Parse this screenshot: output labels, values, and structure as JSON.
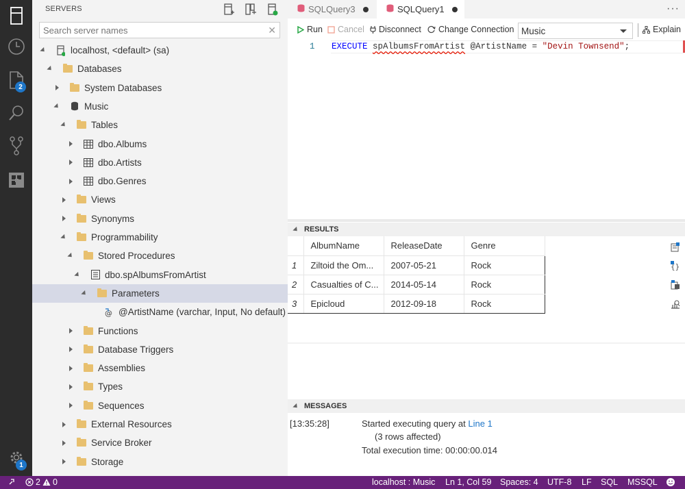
{
  "activity_bar": {
    "explorer_badge": "2",
    "settings_badge": "1"
  },
  "sidebar": {
    "title": "SERVERS",
    "search_placeholder": "Search server names",
    "tree": [
      {
        "label": "localhost, <default> (sa)",
        "depth": 0,
        "state": "expanded",
        "icon": "server-icon"
      },
      {
        "label": "Databases",
        "depth": 1,
        "state": "expanded",
        "icon": "folder-icon"
      },
      {
        "label": "System Databases",
        "depth": 2,
        "state": "collapsed",
        "icon": "folder-icon"
      },
      {
        "label": "Music",
        "depth": 2,
        "state": "expanded",
        "icon": "database-icon"
      },
      {
        "label": "Tables",
        "depth": 3,
        "state": "expanded",
        "icon": "folder-icon"
      },
      {
        "label": "dbo.Albums",
        "depth": 4,
        "state": "collapsed",
        "icon": "table-icon"
      },
      {
        "label": "dbo.Artists",
        "depth": 4,
        "state": "collapsed",
        "icon": "table-icon"
      },
      {
        "label": "dbo.Genres",
        "depth": 4,
        "state": "collapsed",
        "icon": "table-icon"
      },
      {
        "label": "Views",
        "depth": 3,
        "state": "collapsed",
        "icon": "folder-icon"
      },
      {
        "label": "Synonyms",
        "depth": 3,
        "state": "collapsed",
        "icon": "folder-icon"
      },
      {
        "label": "Programmability",
        "depth": 3,
        "state": "expanded",
        "icon": "folder-icon"
      },
      {
        "label": "Stored Procedures",
        "depth": 4,
        "state": "expanded",
        "icon": "folder-icon"
      },
      {
        "label": "dbo.spAlbumsFromArtist",
        "depth": 5,
        "state": "expanded",
        "icon": "stored-procedure-icon"
      },
      {
        "label": "Parameters",
        "depth": 6,
        "state": "expanded",
        "icon": "folder-icon",
        "selected": true
      },
      {
        "label": "@ArtistName (varchar, Input, No default)",
        "depth": 7,
        "state": "leaf",
        "icon": "parameter-icon"
      },
      {
        "label": "Functions",
        "depth": 4,
        "state": "collapsed",
        "icon": "folder-icon"
      },
      {
        "label": "Database Triggers",
        "depth": 4,
        "state": "collapsed",
        "icon": "folder-icon"
      },
      {
        "label": "Assemblies",
        "depth": 4,
        "state": "collapsed",
        "icon": "folder-icon"
      },
      {
        "label": "Types",
        "depth": 4,
        "state": "collapsed",
        "icon": "folder-icon"
      },
      {
        "label": "Sequences",
        "depth": 4,
        "state": "collapsed",
        "icon": "folder-icon"
      },
      {
        "label": "External Resources",
        "depth": 3,
        "state": "collapsed",
        "icon": "folder-icon"
      },
      {
        "label": "Service Broker",
        "depth": 3,
        "state": "collapsed",
        "icon": "folder-icon"
      },
      {
        "label": "Storage",
        "depth": 3,
        "state": "collapsed",
        "icon": "folder-icon"
      }
    ]
  },
  "tabs": [
    {
      "label": "SQLQuery3",
      "active": false
    },
    {
      "label": "SQLQuery1",
      "active": true
    }
  ],
  "more_actions": "···",
  "toolbar": {
    "run": "Run",
    "cancel": "Cancel",
    "disconnect": "Disconnect",
    "change_connection": "Change Connection",
    "database": "Music",
    "explain": "Explain"
  },
  "editor": {
    "line_number": "1",
    "keyword": "EXECUTE",
    "procedure": "spAlbumsFromArtist",
    "middle": " @ArtistName = ",
    "string": "\"Devin Townsend\"",
    "end": ";"
  },
  "results": {
    "header": "RESULTS",
    "columns": [
      "AlbumName",
      "ReleaseDate",
      "Genre"
    ],
    "rows": [
      {
        "n": "1",
        "cells": [
          "Ziltoid the Om...",
          "2007-05-21",
          "Rock"
        ]
      },
      {
        "n": "2",
        "cells": [
          "Casualties of C...",
          "2014-05-14",
          "Rock"
        ]
      },
      {
        "n": "3",
        "cells": [
          "Epicloud",
          "2012-09-18",
          "Rock"
        ]
      }
    ]
  },
  "messages": {
    "header": "MESSAGES",
    "time": "[13:35:28]",
    "line1_prefix": "Started executing query at ",
    "line1_link": "Line 1",
    "line2": "(3 rows affected)",
    "line3": "Total execution time: 00:00:00.014"
  },
  "statusbar": {
    "errors": "2",
    "warnings": "0",
    "connection": "localhost : Music",
    "position": "Ln 1, Col 59",
    "spaces": "Spaces: 4",
    "encoding": "UTF-8",
    "eol": "LF",
    "language": "SQL",
    "provider": "MSSQL"
  },
  "colors": {
    "activity_bar": "#2c2c2c",
    "sidebar": "#f3f3f3",
    "status_bar": "#68217a",
    "selection": "#d6d9e6",
    "badge": "#1e76c8",
    "folder": "#e8c06f",
    "link": "#1e76c8"
  }
}
